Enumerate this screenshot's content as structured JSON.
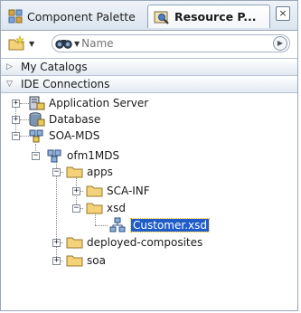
{
  "tabs": [
    {
      "label": "Component Palette",
      "icon": "grid-palette-icon"
    },
    {
      "label": "Resource P...",
      "icon": "resource-palette-icon",
      "close": "×"
    }
  ],
  "toolbar": {
    "new_icon": "folder-new-icon",
    "search_icon": "binoculars-icon",
    "search_placeholder": "Name",
    "go_label": "▶"
  },
  "sections": {
    "my_catalogs": "My Catalogs",
    "ide_connections": "IDE Connections"
  },
  "tree": {
    "application_server": "Application Server",
    "database": "Database",
    "soa_mds": "SOA-MDS",
    "ofm1mds": "ofm1MDS",
    "apps": "apps",
    "soa_inf": "SCA-INF",
    "xsd": "xsd",
    "customer_xsd": "Customer.xsd",
    "deployed_composites": "deployed-composites",
    "soa": "soa"
  },
  "expander": {
    "plus": "+",
    "minus": "−"
  }
}
